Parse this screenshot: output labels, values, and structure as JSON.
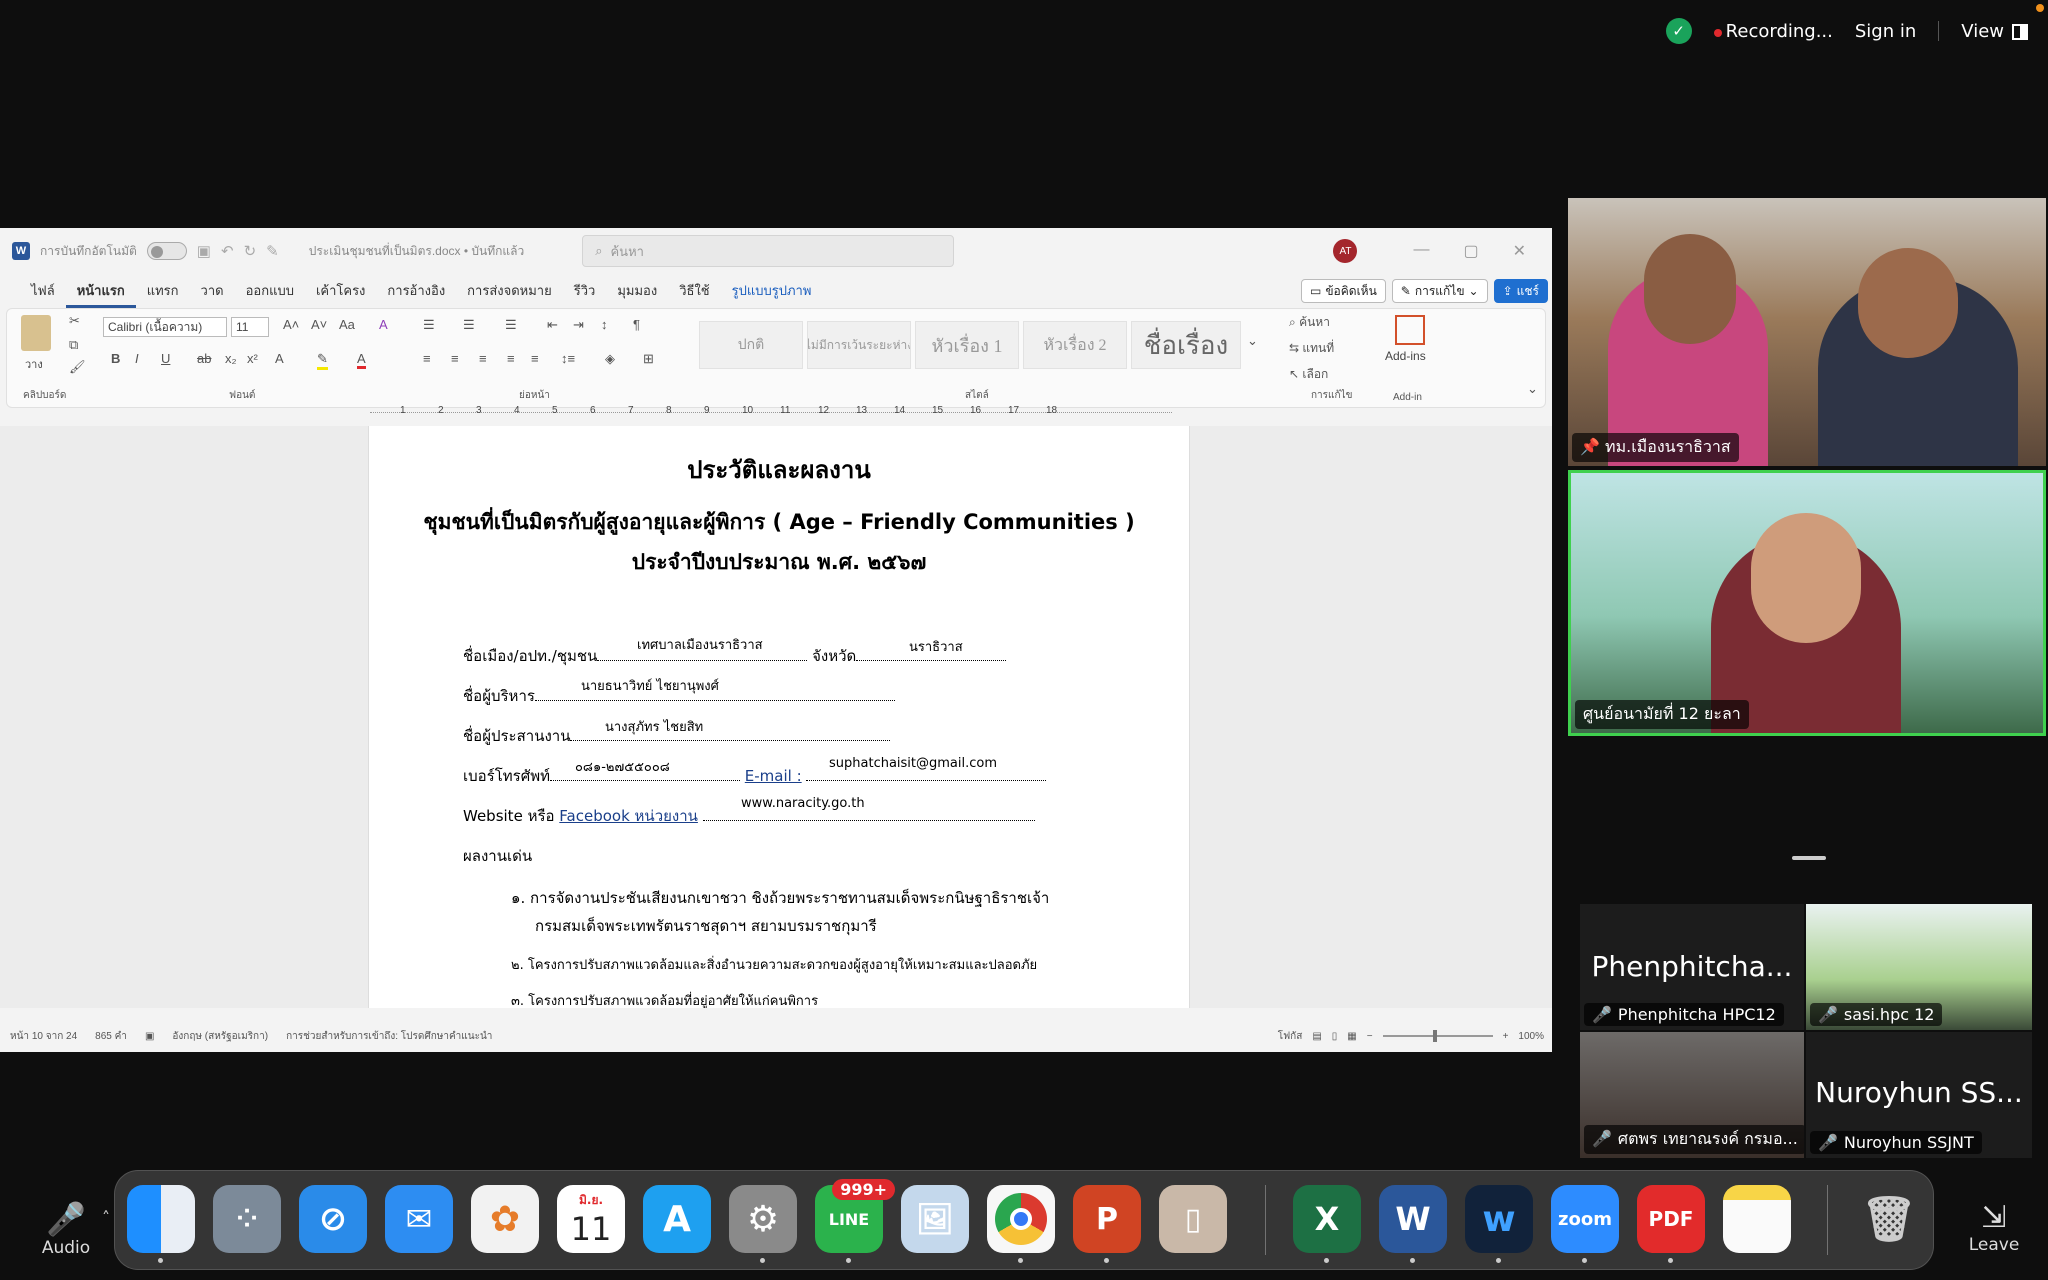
{
  "zoom_bar": {
    "recording": "Recording...",
    "sign_in": "Sign in",
    "view": "View"
  },
  "word": {
    "autosave_label": "การบันทึกอัตโนมัติ",
    "doc_title": "ประเมินชุมชนที่เป็นมิตร.docx • บันทึกแล้ว",
    "search_placeholder": "ค้นหา",
    "avatar": "AT",
    "tabs": [
      "ไฟล์",
      "หน้าแรก",
      "แทรก",
      "วาด",
      "ออกแบบ",
      "เค้าโครง",
      "การอ้างอิง",
      "การส่งจดหมาย",
      "รีวิว",
      "มุมมอง",
      "วิธีใช้",
      "รูปแบบรูปภาพ"
    ],
    "comment_btn": "ข้อคิดเห็น",
    "editing_btn": "การแก้ไข",
    "share_btn": "แชร์",
    "ribbon": {
      "paste": "วาง",
      "clipboard": "คลิปบอร์ด",
      "font_name": "Calibri (เนื้อความ)",
      "font_size": "11",
      "font_group": "ฟอนต์",
      "paragraph_group": "ย่อหน้า",
      "styles": [
        "ปกติ",
        "ไม่มีการเว้นระยะห่าง",
        "หัวเรื่อง 1",
        "หัวเรื่อง 2",
        "ชื่อเรื่อง"
      ],
      "styles_group": "สไตล์",
      "find": "ค้นหา",
      "replace": "แทนที่",
      "select": "เลือก",
      "editing_group": "การแก้ไข",
      "addins": "Add-ins",
      "addin_group": "Add-in"
    },
    "ruler_numbers": [
      "1",
      "2",
      "3",
      "4",
      "5",
      "6",
      "7",
      "8",
      "9",
      "10",
      "11",
      "12",
      "13",
      "14",
      "15",
      "16",
      "17",
      "18"
    ],
    "doc": {
      "title": "ประวัติและผลงาน",
      "subtitle": "ชุมชนที่เป็นมิตรกับผู้สูงอายุและผู้พิการ ( Age – Friendly Communities )",
      "year": "ประจำปีงบประมาณ พ.ศ. ๒๕๖๗",
      "f1_label": "ชื่อเมือง/อปท./ชุมชน",
      "f1_value": "เทศบาลเมืองนราธิวาส",
      "f1b_label": "จังหวัด",
      "f1b_value": "นราธิวาส",
      "f2_label": "ชื่อผู้บริหาร",
      "f2_value": "นายธนาวิทย์  ไชยานุพงศ์",
      "f3_label": "ชื่อผู้ประสานงาน",
      "f3_value": "นางสุภัทร  ไชยสิท",
      "f4_label": "เบอร์โทรศัพท์",
      "f4_value": "๐๘๑-๒๗๕๕๐๐๘",
      "f4b_label": "E-mail :",
      "f4b_value": "suphatchaisit@gmail.com",
      "f5_label_a": "Website หรือ ",
      "f5_label_b": "Facebook  หน่วยงาน",
      "f5_value": "www.naracity.go.th",
      "section": "ผลงานเด่น",
      "items": [
        "๑. การจัดงานประชันเสียงนกเขาชวา ชิงถ้วยพระราชทานสมเด็จพระกนิษฐาธิราชเจ้า",
        "กรมสมเด็จพระเทพรัตนราชสุดาฯ สยามบรมราชกุมารี",
        "๒. โครงการปรับสภาพแวดล้อมและสิ่งอำนวยความสะดวกของผู้สูงอายุให้เหมาะสมและปลอดภัย",
        "๓. โครงการปรับสภาพแวดล้อมที่อยู่อาศัยให้แก่คนพิการ"
      ]
    },
    "status": {
      "page": "หน้า 10 จาก 24",
      "words": "865 คำ",
      "language": "อังกฤษ (สหรัฐอเมริกา)",
      "accessibility": "การช่วยสำหรับการเข้าถึง: โปรดศึกษาคำแนะนำ",
      "focus": "โฟกัส",
      "zoom": "100%"
    }
  },
  "participants": {
    "tile1": "ทม.เมืองนราธิวาส",
    "tile2": "ศูนย์อนามัยที่ 12 ยะลา",
    "tile3_big": "Phenphitcha...",
    "tile3_name": "Phenphitcha HPC12",
    "tile4_name": "sasi.hpc 12",
    "tile5_name": "ศตพร เทยาณรงค์ กรมอ...",
    "tile6_big": "Nuroyhun SS...",
    "tile6_name": "Nuroyhun SSJNT"
  },
  "dock": {
    "audio": "Audio",
    "leave": "Leave",
    "calendar_month": "มิ.ย.",
    "calendar_day": "11",
    "line_badge": "999+",
    "zoom_app": "zoom",
    "pdf_app": "PDF"
  },
  "colors": {
    "word_blue": "#2b579a",
    "active_speaker": "#3fd14e",
    "recording": "#e0292d"
  }
}
